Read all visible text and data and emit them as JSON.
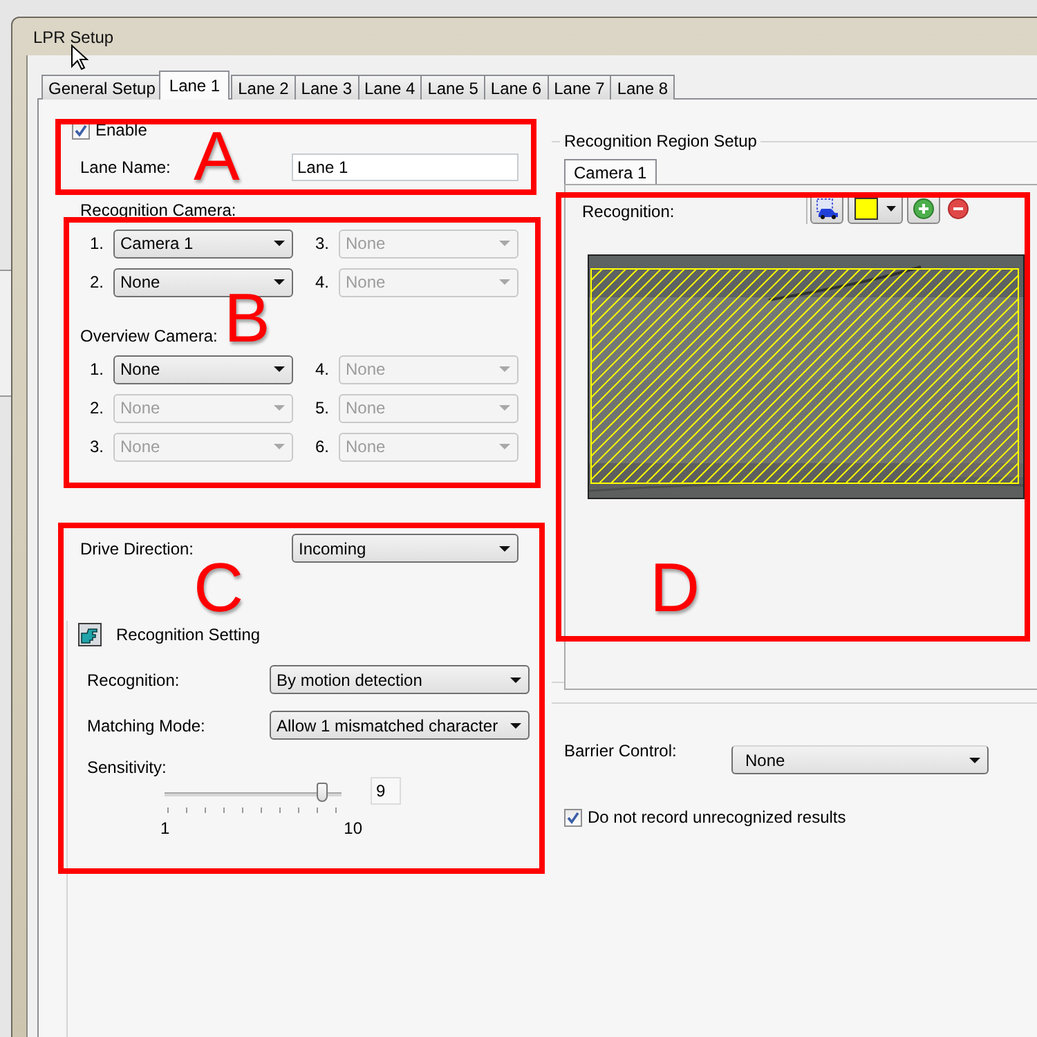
{
  "window": {
    "title": "LPR Setup"
  },
  "tabs": [
    {
      "label": "General Setup",
      "selected": false
    },
    {
      "label": "Lane 1",
      "selected": true
    },
    {
      "label": "Lane 2",
      "selected": false
    },
    {
      "label": "Lane 3",
      "selected": false
    },
    {
      "label": "Lane 4",
      "selected": false
    },
    {
      "label": "Lane 5",
      "selected": false
    },
    {
      "label": "Lane 6",
      "selected": false
    },
    {
      "label": "Lane 7",
      "selected": false
    },
    {
      "label": "Lane 8",
      "selected": false
    }
  ],
  "lane": {
    "enable": {
      "label": "Enable",
      "checked": true
    },
    "lane_name": {
      "label": "Lane Name:",
      "value": "Lane 1"
    }
  },
  "recognition_camera": {
    "label": "Recognition Camera:",
    "slots": [
      {
        "number": "1.",
        "value": "Camera 1",
        "disabled": false
      },
      {
        "number": "2.",
        "value": "None",
        "disabled": false
      },
      {
        "number": "3.",
        "value": "None",
        "disabled": true
      },
      {
        "number": "4.",
        "value": "None",
        "disabled": true
      }
    ]
  },
  "overview_camera": {
    "label": "Overview Camera:",
    "slots": [
      {
        "number": "1.",
        "value": "None",
        "disabled": false
      },
      {
        "number": "2.",
        "value": "None",
        "disabled": true
      },
      {
        "number": "3.",
        "value": "None",
        "disabled": true
      },
      {
        "number": "4.",
        "value": "None",
        "disabled": true
      },
      {
        "number": "5.",
        "value": "None",
        "disabled": true
      },
      {
        "number": "6.",
        "value": "None",
        "disabled": true
      }
    ]
  },
  "drive_direction": {
    "label": "Drive Direction:",
    "value": "Incoming"
  },
  "recognition_setting": {
    "title": "Recognition Setting",
    "fields": [
      {
        "label": "Recognition:",
        "value": "By motion detection"
      },
      {
        "label": "Matching Mode:",
        "value": "Allow 1 mismatched character"
      }
    ],
    "sensitivity": {
      "label": "Sensitivity:",
      "level": 0.889,
      "value": "9",
      "min_label": "1",
      "max_label": "10"
    }
  },
  "region_setup": {
    "title": "Recognition Region Setup",
    "tabs": [
      {
        "label": "Camera 1",
        "selected": true
      }
    ],
    "label": "Recognition:"
  },
  "barrier_control": {
    "label": "Barrier Control:",
    "value": "None"
  },
  "do_not_record": {
    "label": "Do not record unrecognized results",
    "checked": true
  },
  "annotations": [
    {
      "label": "A"
    },
    {
      "label": "B"
    },
    {
      "label": "C"
    },
    {
      "label": "D"
    }
  ]
}
